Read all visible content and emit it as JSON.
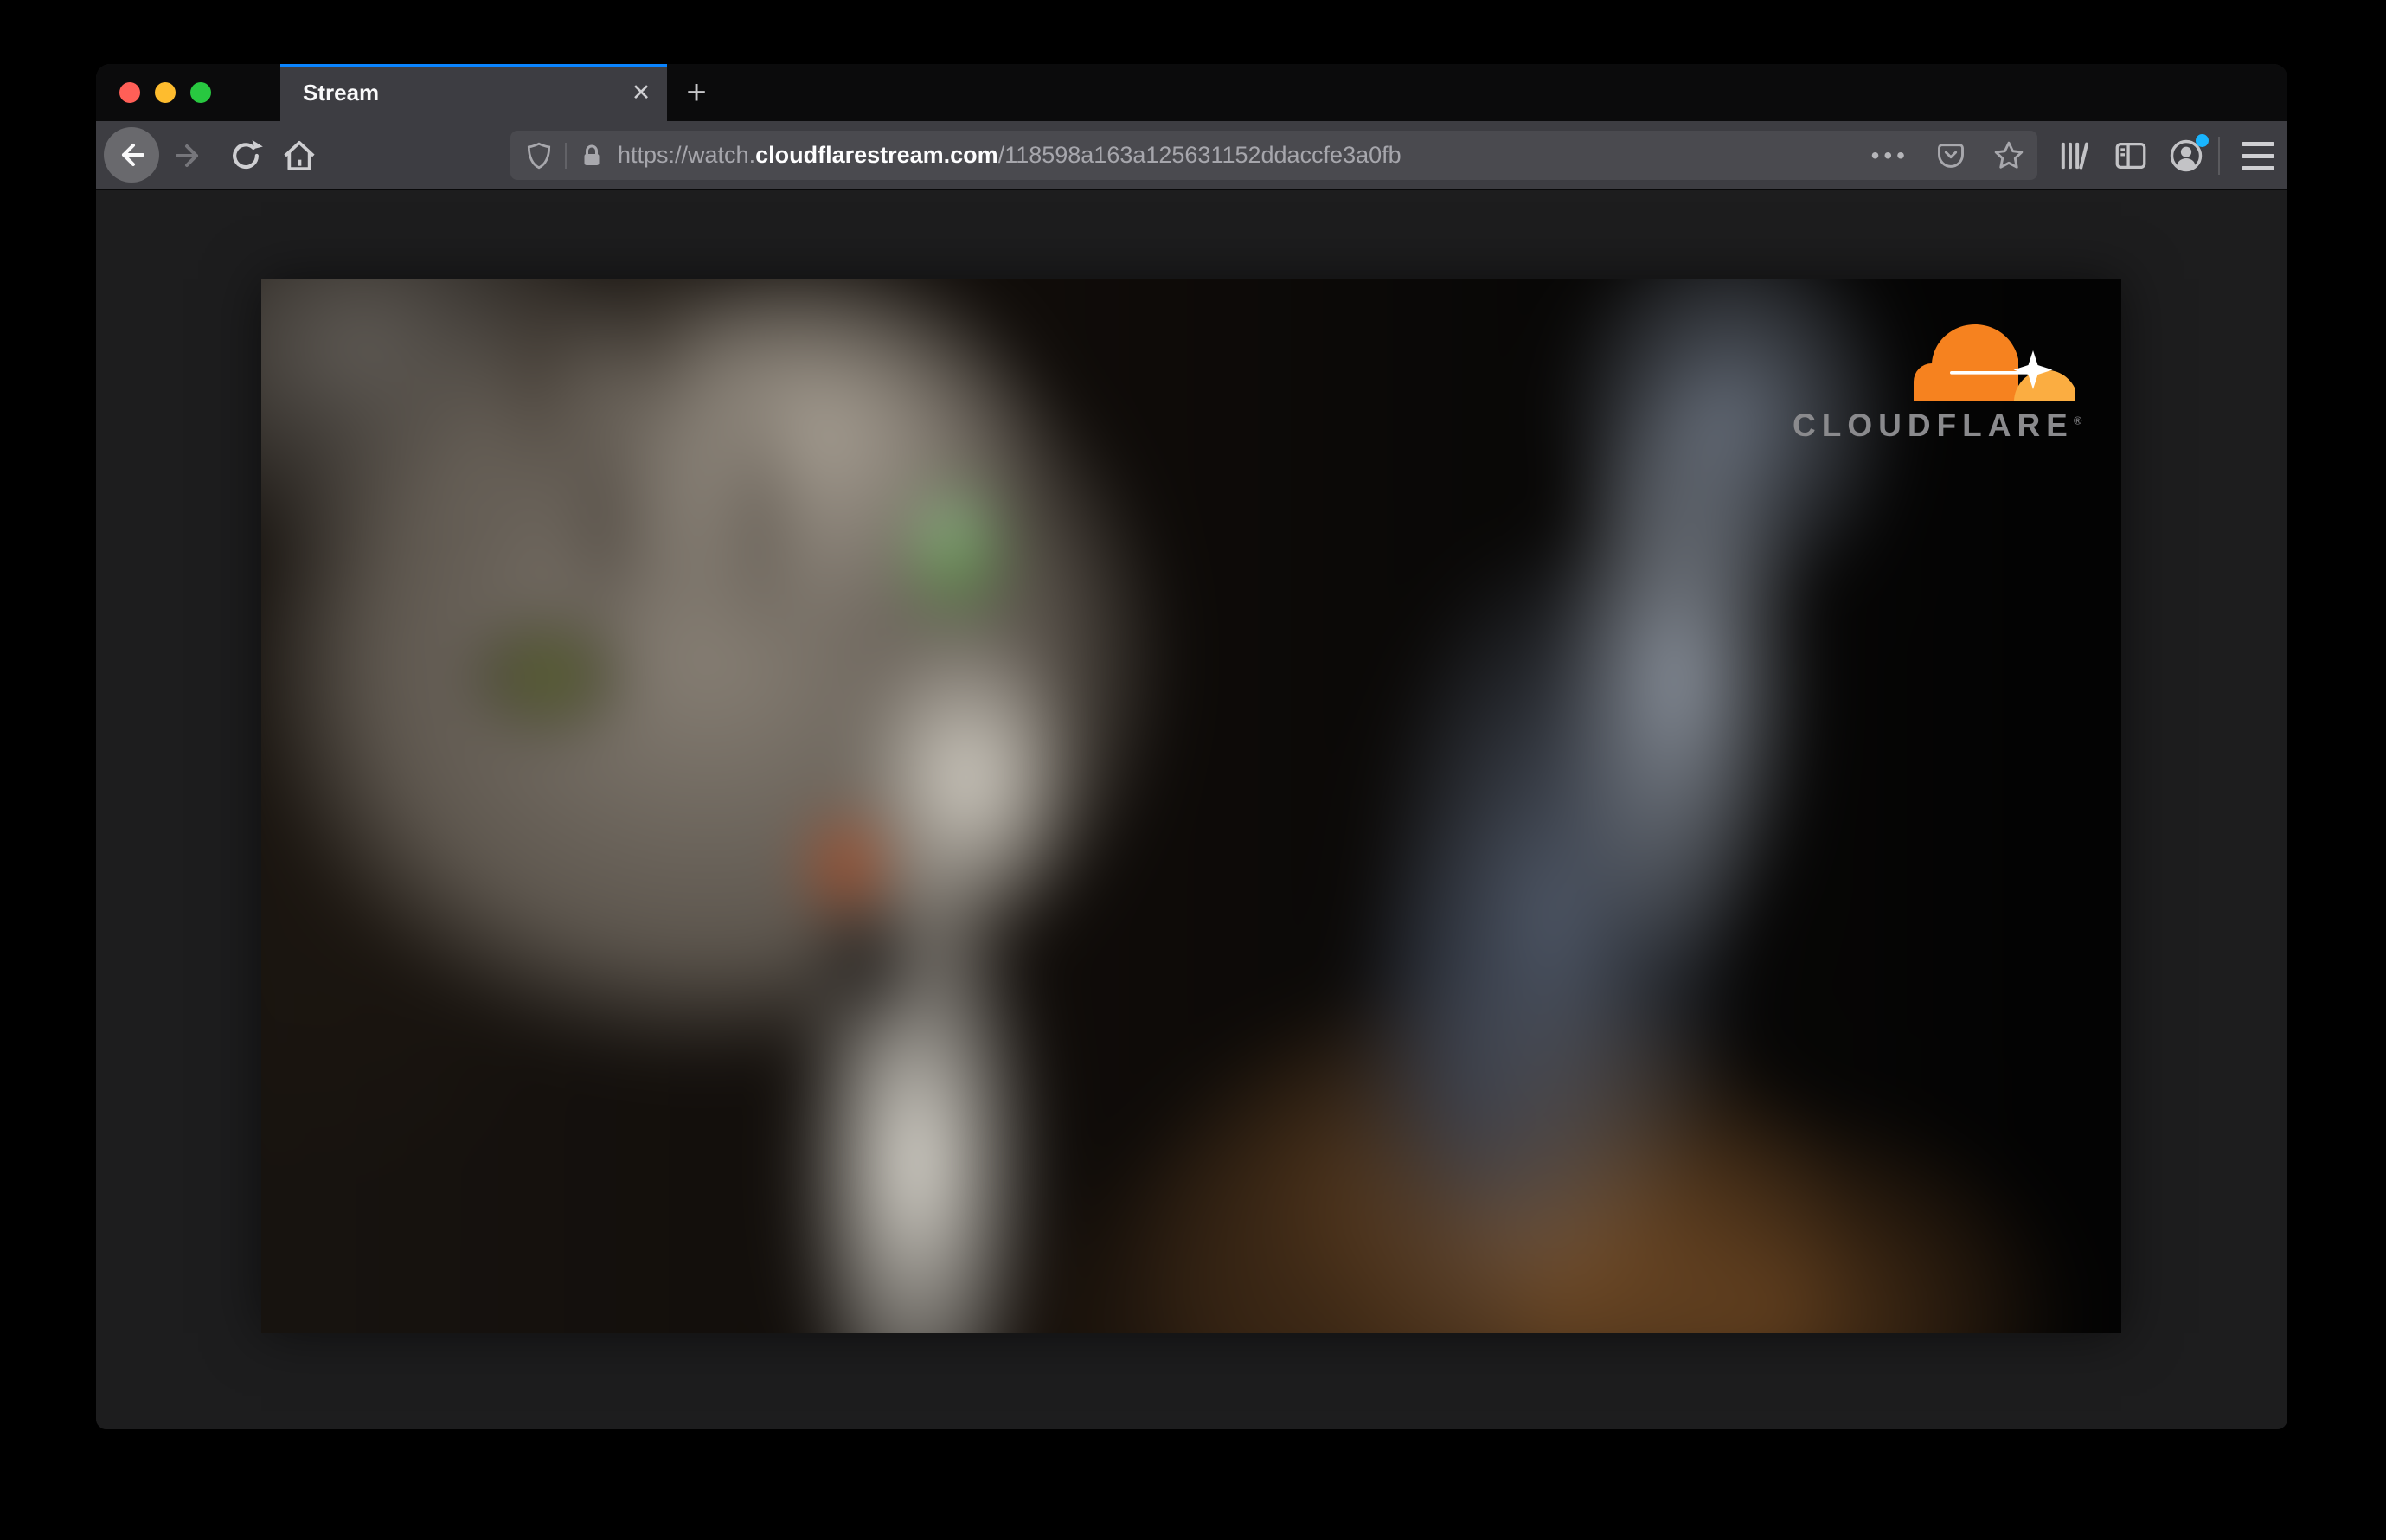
{
  "browser": {
    "tab": {
      "title": "Stream",
      "close_glyph": "✕",
      "new_tab_glyph": "+"
    },
    "address_bar": {
      "url_prefix": "https://watch.",
      "url_domain": "cloudflarestream.com",
      "url_path": "/118598a163a125631152ddaccfe3a0fb",
      "page_actions_glyph": "•••"
    },
    "icons": {
      "back": "left-arrow",
      "forward": "right-arrow",
      "reload": "circular-arrow",
      "home": "house",
      "tracking_protection": "shield",
      "connection_security": "padlock",
      "pocket": "pocket-badge-chevron",
      "bookmark": "star-outline",
      "library": "books",
      "sidebar": "panel-left",
      "account": "person-in-circle",
      "menu": "hamburger"
    }
  },
  "video_player": {
    "brand_wordmark": "CLOUDFLARE",
    "brand_trademark": "®"
  },
  "colors": {
    "accent_blue": "#0a84ff",
    "traffic_red": "#ff5f57",
    "traffic_yellow": "#febc2e",
    "traffic_green": "#28c840",
    "cloudflare_orange": "#f6821f",
    "cloudflare_orange_light": "#fbad41",
    "notification_dot": "#19b5fe"
  }
}
